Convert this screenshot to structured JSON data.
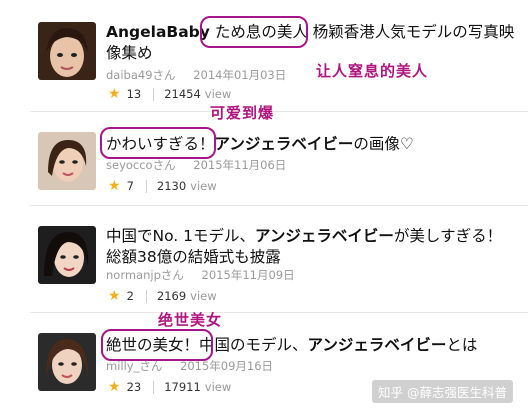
{
  "items": [
    {
      "title_bold": "AngelaBaby",
      "title_rest": "ため息の美人 杨颖香港人気モデルの写真映像集め",
      "user": "daiba49さん",
      "date": "2014年01月03日",
      "stars": "13",
      "views": "21454",
      "views_label": "view",
      "annotation": "让人窒息的美人"
    },
    {
      "title_plain": "かわいすぎる！",
      "title_bold": "アンジェラベイビー",
      "title_rest": "の画像♡",
      "user": "seyoccoさん",
      "date": "2015年11月06日",
      "stars": "7",
      "views": "2130",
      "views_label": "view",
      "annotation": "可爱到爆"
    },
    {
      "title_plain": "中国でNo. 1モデル、",
      "title_bold": "アンジェラベイビー",
      "title_rest": "が美しすぎる！ 総額38億の結婚式も披露",
      "user": "normanjpさん",
      "date": "2015年11月09日",
      "stars": "2",
      "views": "2169",
      "views_label": "view"
    },
    {
      "title_plain": "絶世の美女！",
      "title_mid": "中国のモデル、",
      "title_bold": "アンジェラベイビー",
      "title_rest": "とは",
      "user": "milly_さん",
      "date": "2015年09月16日",
      "stars": "23",
      "views": "17911",
      "views_label": "view",
      "annotation": "绝世美女"
    }
  ],
  "watermark": "知乎 @薛志强医生科普",
  "colors": {
    "annotation": "#b0157f",
    "star": "#f2b01e"
  }
}
